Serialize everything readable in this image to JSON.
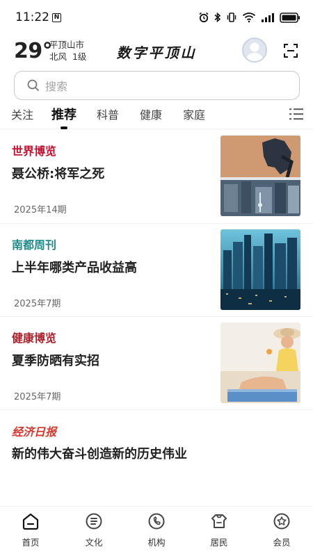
{
  "status": {
    "time": "11:22",
    "nfc_label": "N"
  },
  "header": {
    "temperature": "29°",
    "city": "平顶山市",
    "wind": "北风  1级",
    "brand": "数字平顶山"
  },
  "search": {
    "placeholder": "搜索"
  },
  "tabs": [
    {
      "label": "关注",
      "active": false
    },
    {
      "label": "推荐",
      "active": true
    },
    {
      "label": "科普",
      "active": false
    },
    {
      "label": "健康",
      "active": false
    },
    {
      "label": "家庭",
      "active": false
    }
  ],
  "articles": [
    {
      "source": "世界博览",
      "source_color": "#c8102e",
      "title": "聂公桥:将军之死",
      "date": "2025年14期"
    },
    {
      "source": "南都周刊",
      "source_color": "#1f8a8a",
      "title": "上半年哪类产品收益高",
      "date": "2025年7期"
    },
    {
      "source": "健康博览",
      "source_color": "#b01e2a",
      "title": "夏季防晒有实招",
      "date": "2025年7期"
    },
    {
      "source": "经济日报",
      "source_color": "#d9352a",
      "title": "新的伟大奋斗创造新的历史伟业"
    }
  ],
  "bottom_nav": [
    {
      "label": "首页",
      "icon": "home-icon",
      "active": true
    },
    {
      "label": "文化",
      "icon": "culture-icon"
    },
    {
      "label": "机构",
      "icon": "institution-icon"
    },
    {
      "label": "居民",
      "icon": "resident-icon"
    },
    {
      "label": "会员",
      "icon": "member-icon"
    }
  ]
}
